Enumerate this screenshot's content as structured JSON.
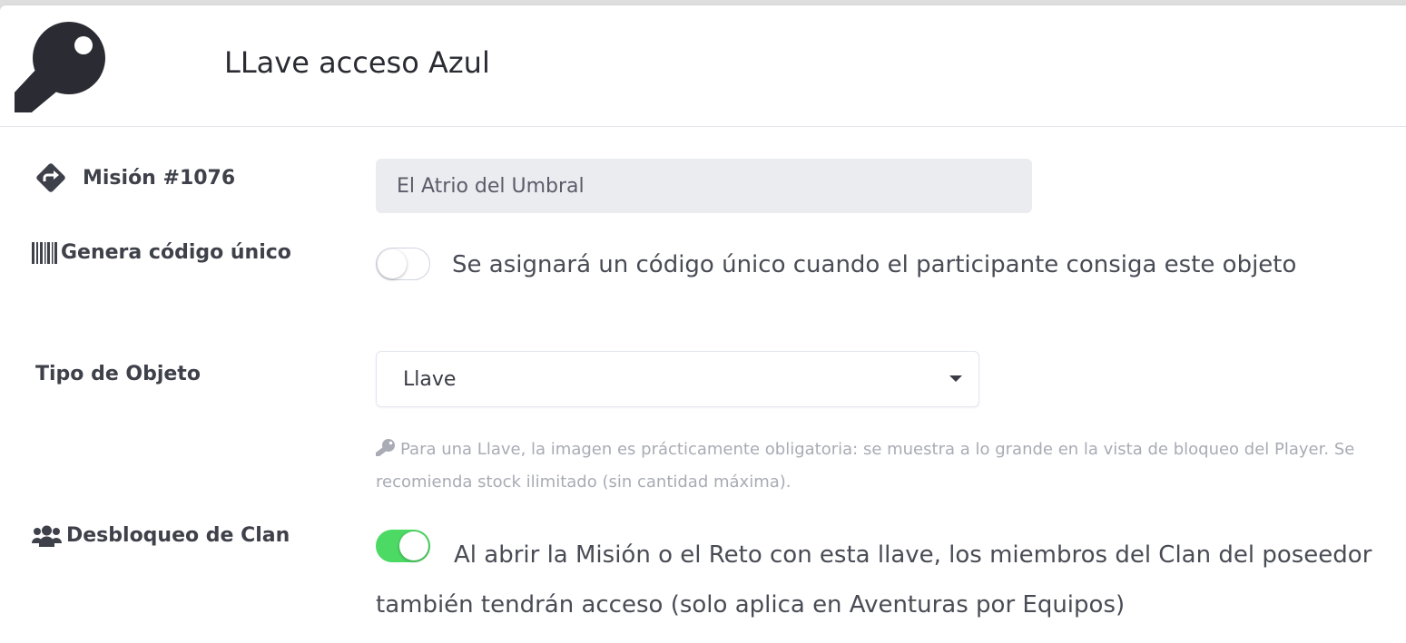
{
  "header": {
    "icon": "key-icon",
    "title": "LLave acceso Azul"
  },
  "mission": {
    "icon": "directions-icon",
    "label": "Misión #1076",
    "value": "El Atrio del Umbral"
  },
  "unique_code": {
    "icon": "barcode-icon",
    "label": "Genera código único",
    "enabled": false,
    "description": "Se asignará un código único cuando el participante consiga este objeto"
  },
  "object_type": {
    "label": "Tipo de Objeto",
    "selected": "Llave",
    "help_icon": "key-icon",
    "help_text": "Para una Llave, la imagen es prácticamente obligatoria: se muestra a lo grande en la vista de bloqueo del Player. Se recomienda stock ilimitado (sin cantidad máxima)."
  },
  "clan_unlock": {
    "icon": "users-icon",
    "label": "Desbloqueo de Clan",
    "enabled": true,
    "description": "Al abrir la Misión o el Reto con esta llave, los miembros del Clan del poseedor también tendrán acceso (solo aplica en Aventuras por Equipos)"
  },
  "colors": {
    "toggle_on": "#4cd964",
    "field_bg": "#eaecf0",
    "help_text": "#a9abb5"
  }
}
